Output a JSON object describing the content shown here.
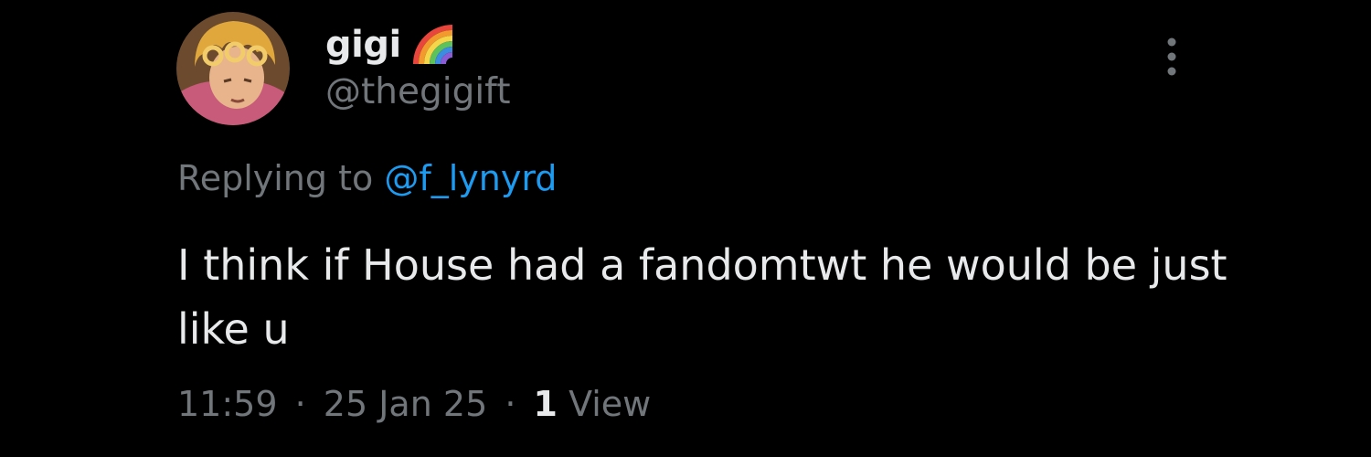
{
  "author": {
    "display_name": "gigi",
    "handle": "@thegigift",
    "badge_icon": "rainbow-icon",
    "avatar_icon": "avatar"
  },
  "reply": {
    "prefix": "Replying to",
    "mention": "@f_lynyrd"
  },
  "tweet": {
    "text": "I think if House had a fandomtwt he would be just like u"
  },
  "meta": {
    "time": "11:59",
    "separator": "·",
    "date": "25 Jan 25",
    "views_count": "1",
    "views_label": "View"
  },
  "colors": {
    "background": "#000000",
    "primary_text": "#e7e9ea",
    "secondary_text": "#71767b",
    "link": "#1d9bf0"
  },
  "menu": {
    "icon": "more-vertical-icon"
  }
}
